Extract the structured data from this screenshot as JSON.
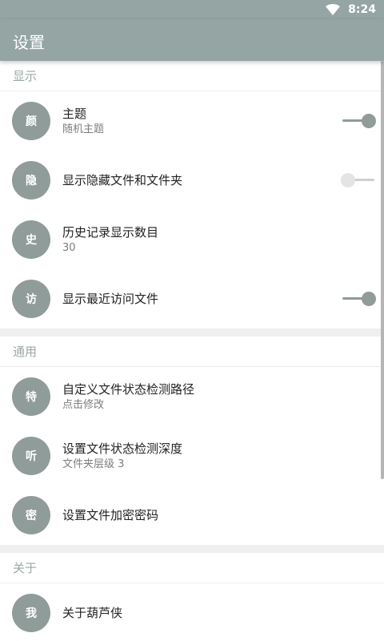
{
  "statusbar": {
    "time": "8:24",
    "icon": "wifi-icon"
  },
  "appbar": {
    "title": "设置"
  },
  "colors": {
    "accent": "#95a5a3",
    "avatar": "#8f9c9a",
    "section_header": "#9aa9a7"
  },
  "sections": [
    {
      "header": "显示",
      "items": [
        {
          "avatar": "颜",
          "title": "主题",
          "subtitle": "随机主题",
          "toggle": true
        },
        {
          "avatar": "隐",
          "title": "显示隐藏文件和文件夹",
          "toggle": false
        },
        {
          "avatar": "史",
          "title": "历史记录显示数目",
          "subtitle": "30"
        },
        {
          "avatar": "访",
          "title": "显示最近访问文件",
          "toggle": true
        }
      ]
    },
    {
      "header": "通用",
      "items": [
        {
          "avatar": "特",
          "title": "自定义文件状态检测路径",
          "subtitle": "点击修改"
        },
        {
          "avatar": "听",
          "title": "设置文件状态检测深度",
          "subtitle": "文件夹层级 3"
        },
        {
          "avatar": "密",
          "title": "设置文件加密密码"
        }
      ]
    },
    {
      "header": "关于",
      "items": [
        {
          "avatar": "我",
          "title": "关于葫芦侠"
        }
      ]
    }
  ]
}
